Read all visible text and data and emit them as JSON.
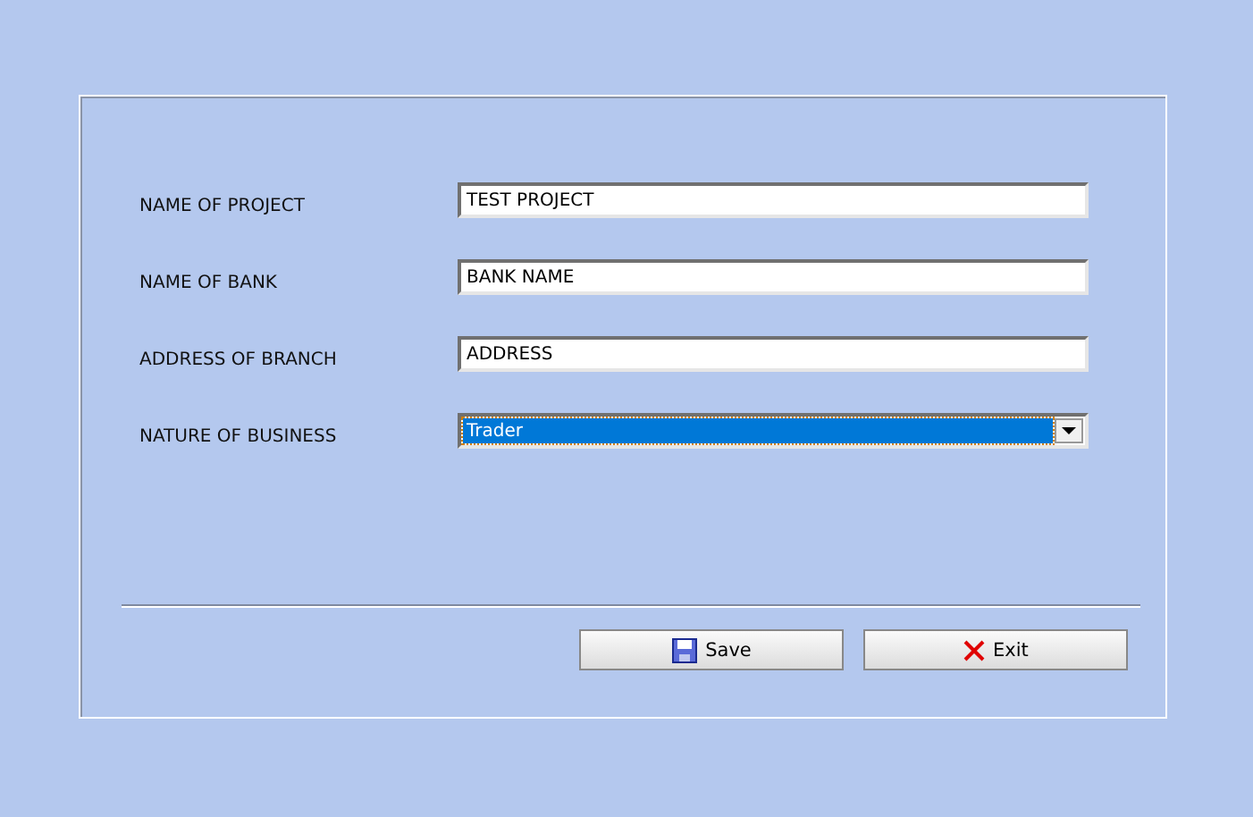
{
  "form": {
    "fields": [
      {
        "kind": "text",
        "label": "NAME OF PROJECT",
        "value": "TEST PROJECT",
        "selected": false
      },
      {
        "kind": "text",
        "label": "NAME OF BANK",
        "value": "BANK NAME",
        "selected": false
      },
      {
        "kind": "text",
        "label": "ADDRESS OF BRANCH",
        "value": "ADDRESS",
        "selected": false
      },
      {
        "kind": "dropdown",
        "label": "NATURE OF BUSINESS",
        "value": "Trader",
        "selected": true
      }
    ]
  },
  "buttons": [
    {
      "kind": "save",
      "label": "Save"
    },
    {
      "kind": "exit",
      "label": "Exit"
    }
  ]
}
